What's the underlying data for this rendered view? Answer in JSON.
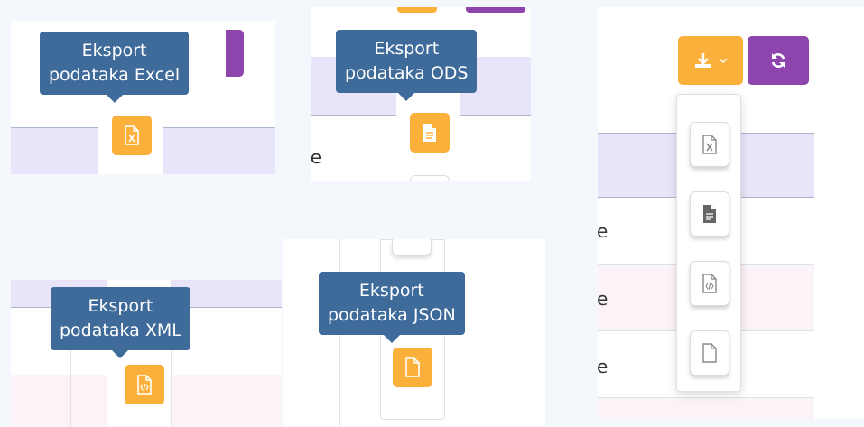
{
  "tooltips": {
    "excel": {
      "line1": "Eksport",
      "line2": "podataka Excel"
    },
    "ods": {
      "line1": "Eksport",
      "line2": "podataka ODS"
    },
    "xml": {
      "line1": "Eksport",
      "line2": "podataka XML"
    },
    "json": {
      "line1": "Eksport",
      "line2": "podataka JSON"
    }
  },
  "table_fragments": {
    "ods_panel_cell": "re",
    "dropdown_rows": [
      "e",
      "e",
      "e"
    ]
  },
  "icons": {
    "download": "download-icon",
    "caret": "chevron-down-icon",
    "refresh": "refresh-icon",
    "excel": "excel-file-icon",
    "ods": "ods-file-icon",
    "xml": "xml-file-icon",
    "json": "json-file-icon"
  },
  "colors": {
    "tooltip": "#3f6b9b",
    "export_button": "#fbb03b",
    "refresh_button": "#8e44ad",
    "header_row": "#e8e4fa",
    "alt_row": "#fbf3f7"
  }
}
